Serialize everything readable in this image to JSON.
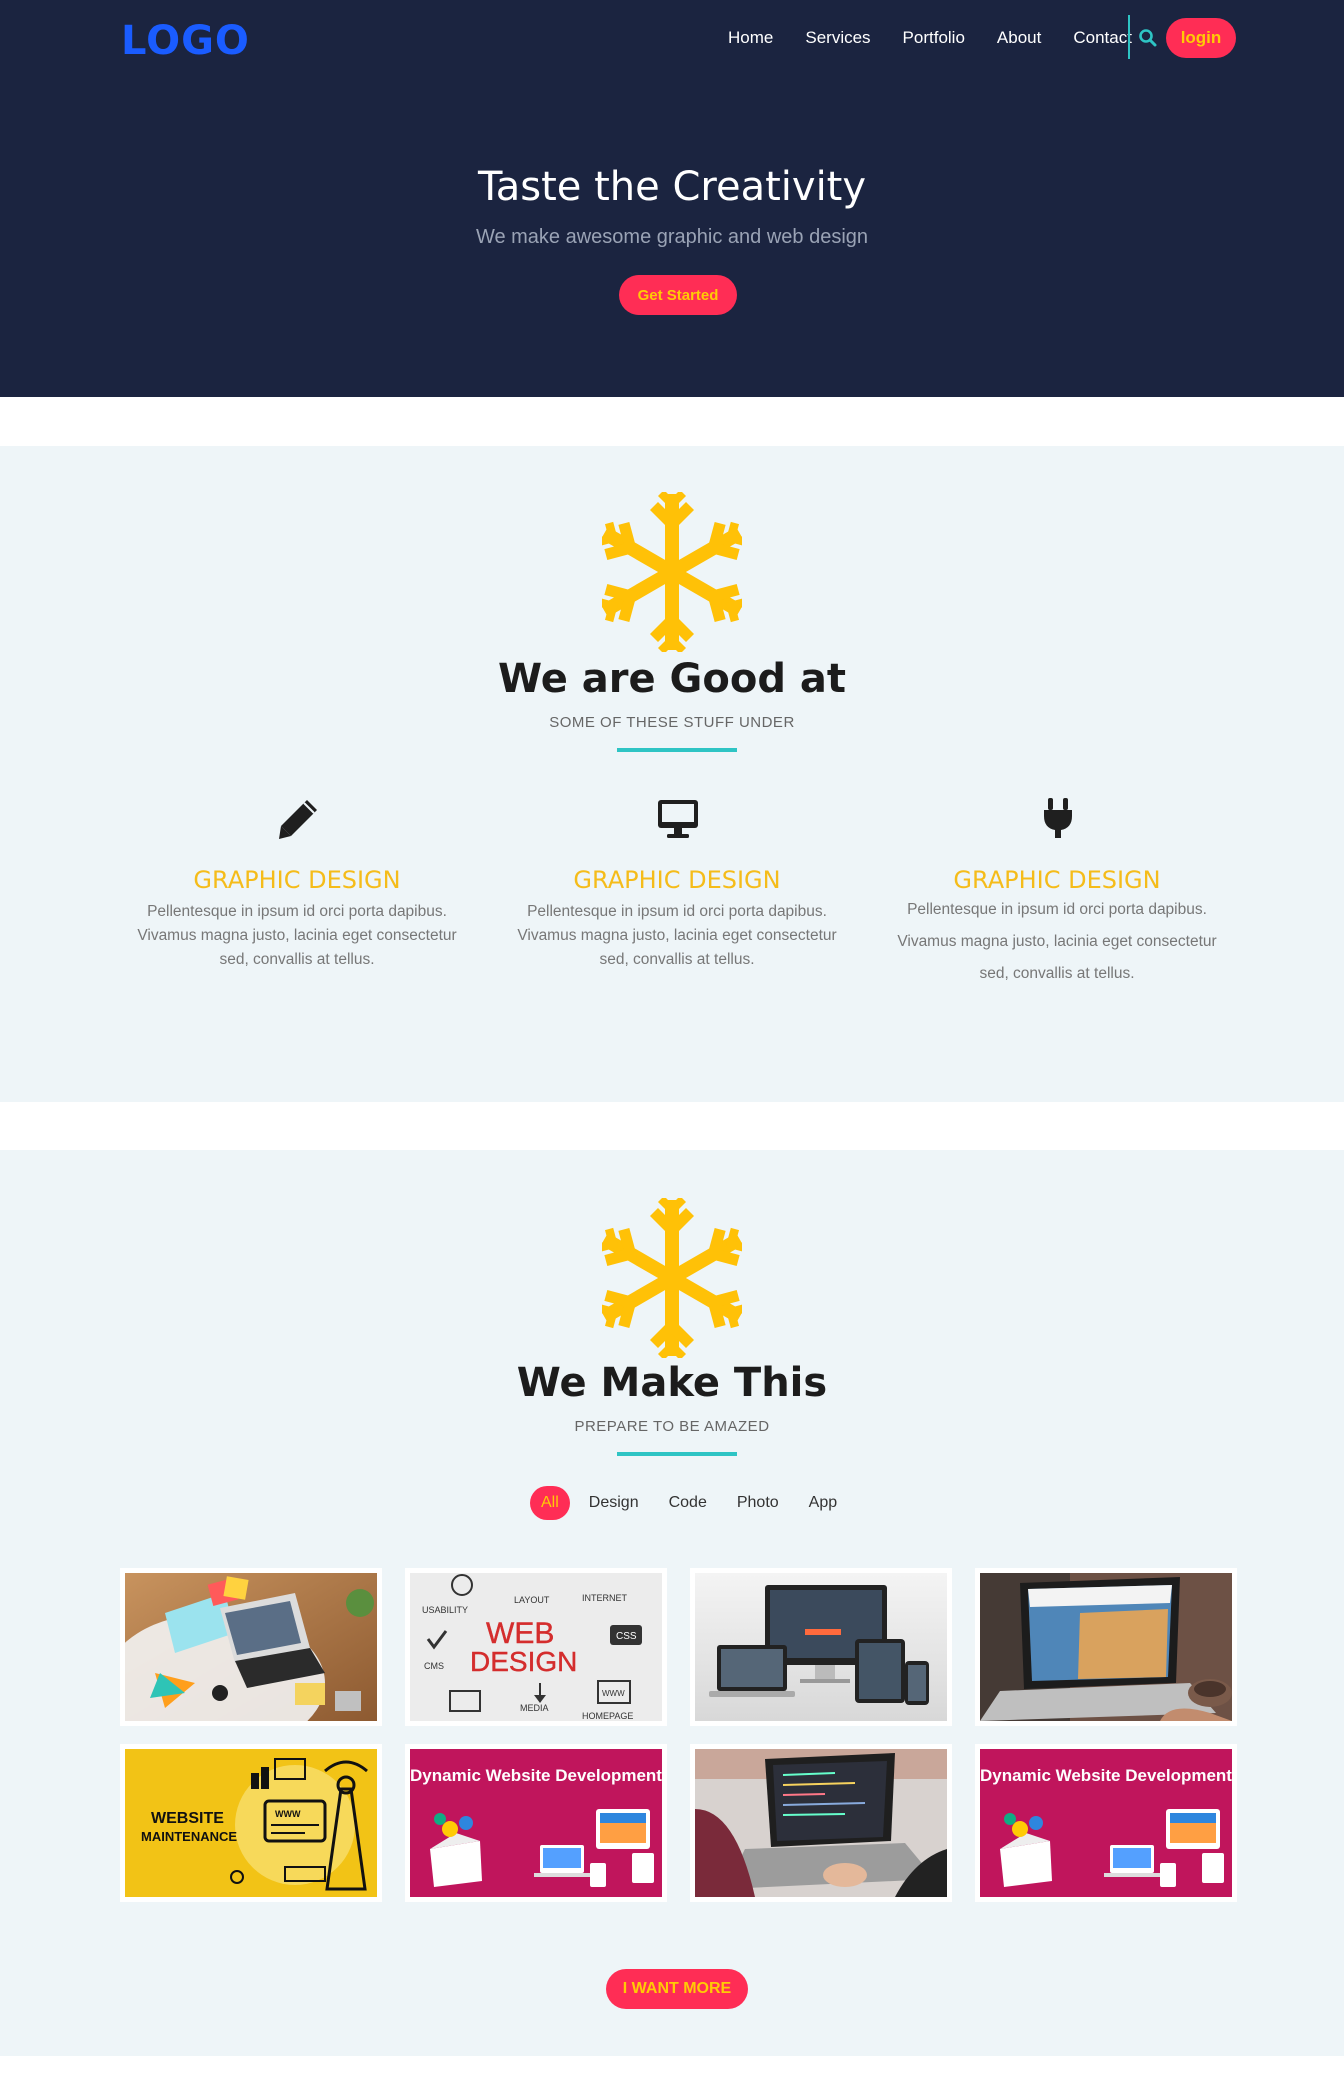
{
  "header": {
    "logo": "LOGO",
    "nav": [
      "Home",
      "Services",
      "Portfolio",
      "About",
      "Contact"
    ],
    "login_label": "login",
    "search_icon": "search-icon"
  },
  "hero": {
    "title": "Taste the Creativity",
    "subtitle": "We make awesome graphic and web design",
    "cta_label": "Get Started"
  },
  "services_section": {
    "icon": "snowflake-icon",
    "title": "We are Good at",
    "subtitle": "SOME OF THESE STUFF UNDER",
    "items": [
      {
        "icon": "pencil-icon",
        "title": "GRAPHIC DESIGN",
        "text": "Pellentesque in ipsum id orci porta dapibus. Vivamus magna justo, lacinia eget consectetur sed, convallis at tellus."
      },
      {
        "icon": "monitor-icon",
        "title": "GRAPHIC DESIGN",
        "text": "Pellentesque in ipsum id orci porta dapibus. Vivamus magna justo, lacinia eget consectetur sed, convallis at tellus."
      },
      {
        "icon": "plug-icon",
        "title": "GRAPHIC DESIGN",
        "text": "Pellentesque in ipsum id orci porta dapibus. Vivamus magna justo, lacinia eget consectetur sed, convallis at tellus."
      }
    ]
  },
  "portfolio_section": {
    "icon": "snowflake-icon",
    "title": "We Make This",
    "subtitle": "PREPARE TO BE AMAZED",
    "filters": [
      "All",
      "Design",
      "Code",
      "Photo",
      "App"
    ],
    "active_filter": "All",
    "tiles": [
      {
        "kind": "desk-photo"
      },
      {
        "kind": "web-design",
        "words": [
          "USABILITY",
          "LAYOUT",
          "INTERNET",
          "WEB",
          "DESIGN",
          "CSS",
          "CMS",
          "WWW",
          "MEDIA",
          "HOMEPAGE"
        ]
      },
      {
        "kind": "responsive-devices"
      },
      {
        "kind": "laptop-photo"
      },
      {
        "kind": "maintenance",
        "words": [
          "WEBSITE",
          "MAINTENANCE",
          "WWW"
        ]
      },
      {
        "kind": "dynamic",
        "heading": "Dynamic Website Development"
      },
      {
        "kind": "coding-photo"
      },
      {
        "kind": "dynamic",
        "heading": "Dynamic Website Development"
      }
    ],
    "more_label": "I WANT MORE"
  },
  "colors": {
    "navy": "#1b2440",
    "accent_red": "#ff2d55",
    "accent_yellow": "#ffcb05",
    "teal": "#2ec4c4",
    "logo_blue": "#1a5cff",
    "section_bg": "#eef5f8",
    "service_title": "#f5bc1a"
  }
}
